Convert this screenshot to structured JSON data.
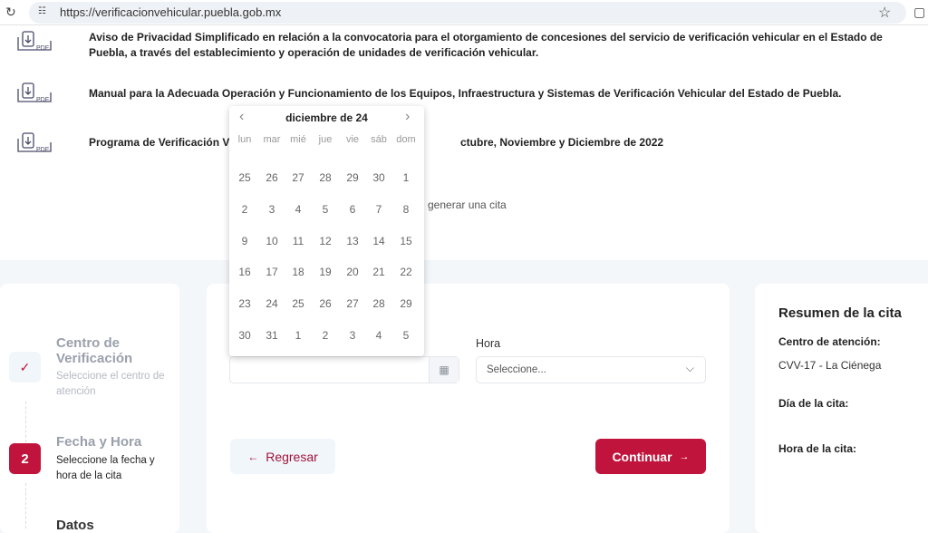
{
  "browser": {
    "url": "https://verificacionvehicular.puebla.gob.mx",
    "reload_icon": "reload-icon",
    "site_icon": "site-settings-icon",
    "star_icon": "star-icon",
    "extensions_icon": "extensions-icon"
  },
  "documents": [
    {
      "icon": "pdf-download-icon",
      "pdf_label": "PDF",
      "text": "Aviso de Privacidad Simplificado en relación a la convocatoria para el otorgamiento de concesiones del servicio de verificación vehicular en el Estado de Puebla, a través del establecimiento y operación de unidades de verificación vehicular."
    },
    {
      "icon": "pdf-download-icon",
      "pdf_label": "PDF",
      "text": "Manual para la Adecuada Operación y Funcionamiento de los Equipos, Infraestructura y Sistemas de Verificación Vehicular del Estado de Puebla."
    },
    {
      "icon": "pdf-download-icon",
      "pdf_label": "PDF",
      "text": "Programa de Verificación Vehicular ... Octubre, Noviembre y Diciembre de 2022",
      "visible_left": "Programa de Verificación Ve",
      "visible_right": "ctubre, Noviembre y Diciembre de 2022"
    }
  ],
  "hint_text": "generar una cita",
  "stepper": [
    {
      "state": "done",
      "title": "Centro de Verificación",
      "subtitle": "Seleccione el centro de atención",
      "icon": "check-icon"
    },
    {
      "state": "active",
      "number": "2",
      "title": "Fecha y Hora",
      "subtitle": "Seleccione la fecha y hora de la cita"
    },
    {
      "state": "pending",
      "title": "Datos"
    }
  ],
  "form": {
    "date_value": "",
    "hora_label": "Hora",
    "hora_placeholder": "Seleccione...",
    "back_label": "Regresar",
    "continue_label": "Continuar"
  },
  "calendar": {
    "title": "diciembre de 24",
    "weekdays": [
      "lun",
      "mar",
      "mié",
      "jue",
      "vie",
      "sáb",
      "dom"
    ],
    "weeks": [
      [
        "25",
        "26",
        "27",
        "28",
        "29",
        "30",
        "1"
      ],
      [
        "2",
        "3",
        "4",
        "5",
        "6",
        "7",
        "8"
      ],
      [
        "9",
        "10",
        "11",
        "12",
        "13",
        "14",
        "15"
      ],
      [
        "16",
        "17",
        "18",
        "19",
        "20",
        "21",
        "22"
      ],
      [
        "23",
        "24",
        "25",
        "26",
        "27",
        "28",
        "29"
      ],
      [
        "30",
        "31",
        "1",
        "2",
        "3",
        "4",
        "5"
      ]
    ]
  },
  "summary": {
    "title": "Resumen de la cita",
    "center_label": "Centro de atención:",
    "center_value": "CVV-17 - La Ciénega",
    "day_label": "Día de la cita:",
    "day_value": "",
    "time_label": "Hora de la cita:",
    "time_value": ""
  },
  "colors": {
    "accent": "#c0143c",
    "accent_light": "#f1f6fa"
  }
}
